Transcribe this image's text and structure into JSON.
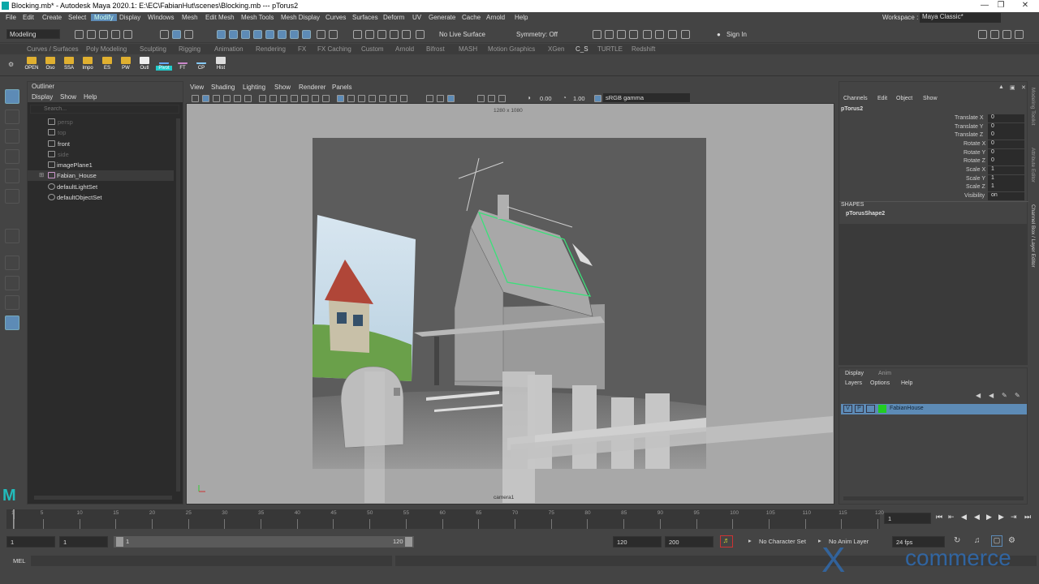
{
  "title_bar": {
    "title": "Blocking.mb* - Autodesk Maya 2020.1: E:\\EC\\FabianHut\\scenes\\Blocking.mb   ---   pTorus2",
    "controls": [
      "—",
      "❐",
      "✕"
    ]
  },
  "menu_bar": {
    "items": [
      "File",
      "Edit",
      "Create",
      "Select",
      "Modify",
      "Display",
      "Windows",
      "Mesh",
      "Edit Mesh",
      "Mesh Tools",
      "Mesh Display",
      "Curves",
      "Surfaces",
      "Deform",
      "UV",
      "Generate",
      "Cache",
      "Arnold",
      "Help"
    ],
    "workspace_label": "Workspace :",
    "workspace_value": "Maya Classic*"
  },
  "status_line": {
    "mode": "Modeling",
    "live_surface": "No Live Surface",
    "symmetry": "Symmetry: Off",
    "sign_in": "Sign In"
  },
  "shelf": {
    "tabs": [
      "Curves / Surfaces",
      "Poly Modeling",
      "Sculpting",
      "Rigging",
      "Animation",
      "Rendering",
      "FX",
      "FX Caching",
      "Custom",
      "Arnold",
      "Bifrost",
      "MASH",
      "Motion Graphics",
      "XGen",
      "C_S",
      "TURTLE",
      "Redshift"
    ],
    "buttons": [
      "OPEN",
      "Oso",
      "SSA",
      "Impo",
      "ES",
      "PW",
      "Outl",
      "Pivot",
      "FT",
      "CP",
      "Hist"
    ],
    "selected_button": "Pivot"
  },
  "outliner": {
    "title": "Outliner",
    "menu": [
      "Display",
      "Show",
      "Help"
    ],
    "search_placeholder": "Search...",
    "items": [
      {
        "label": "persp",
        "dim": true
      },
      {
        "label": "top",
        "dim": true
      },
      {
        "label": "front",
        "dim": false
      },
      {
        "label": "side",
        "dim": true
      },
      {
        "label": "imagePlane1",
        "dim": false
      },
      {
        "label": "Fabian_House",
        "dim": false
      },
      {
        "label": "defaultLightSet",
        "dim": false
      },
      {
        "label": "defaultObjectSet",
        "dim": false
      }
    ]
  },
  "viewport": {
    "menu": [
      "View",
      "Shading",
      "Lighting",
      "Show",
      "Renderer",
      "Panels"
    ],
    "exposure": "0.00",
    "gamma": "1.00",
    "color_space": "sRGB gamma",
    "resolution": "1280 x 1080",
    "camera": "camera1"
  },
  "channel_box": {
    "menu": [
      "Channels",
      "Edit",
      "Object",
      "Show"
    ],
    "object": "pTorus2",
    "attributes": [
      {
        "name": "Translate X",
        "value": "0"
      },
      {
        "name": "Translate Y",
        "value": "0"
      },
      {
        "name": "Translate Z",
        "value": "0"
      },
      {
        "name": "Rotate X",
        "value": "0"
      },
      {
        "name": "Rotate Y",
        "value": "0"
      },
      {
        "name": "Rotate Z",
        "value": "0"
      },
      {
        "name": "Scale X",
        "value": "1"
      },
      {
        "name": "Scale Y",
        "value": "1"
      },
      {
        "name": "Scale Z",
        "value": "1"
      },
      {
        "name": "Visibility",
        "value": "on"
      }
    ],
    "shapes_label": "SHAPES",
    "shape_name": "pTorusShape2"
  },
  "right_tabs": [
    "Modeling Toolkit",
    "Attribute Editor",
    "Channel Box / Layer Editor"
  ],
  "layer_editor": {
    "tabs": [
      "Display",
      "Anim"
    ],
    "menu": [
      "Layers",
      "Options",
      "Help"
    ],
    "layer": {
      "v": "V",
      "p": "P",
      "name": "FabianHouse",
      "color": "#22cc22"
    }
  },
  "time_slider": {
    "ticks": [
      "1",
      "5",
      "10",
      "15",
      "20",
      "25",
      "30",
      "35",
      "40",
      "45",
      "50",
      "55",
      "60",
      "65",
      "70",
      "75",
      "80",
      "85",
      "90",
      "95",
      "100",
      "105",
      "110",
      "115",
      "120"
    ],
    "current_frame": "1"
  },
  "range_slider": {
    "start": "1",
    "start_inner": "1",
    "range_start": "1",
    "range_end": "120",
    "end_inner": "120",
    "end": "200",
    "character_set": "No Character Set",
    "anim_layer": "No Anim Layer",
    "fps": "24 fps"
  },
  "command_line": {
    "label": "MEL"
  },
  "watermark": {
    "prefix": "X",
    "text": "commerce"
  }
}
